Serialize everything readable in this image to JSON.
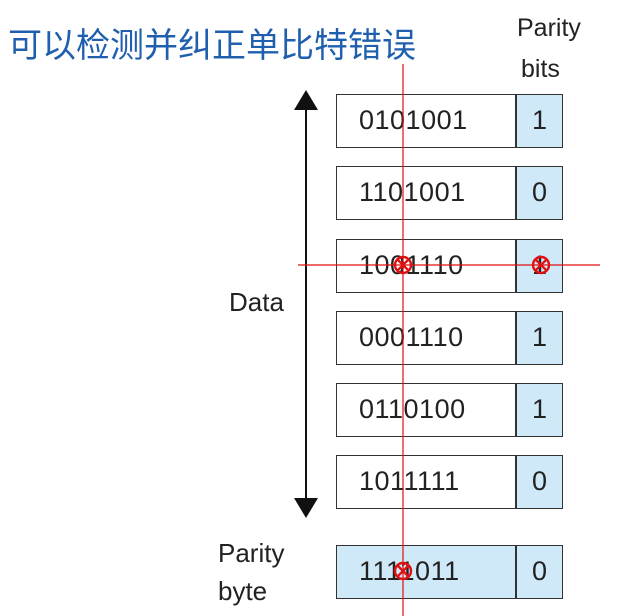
{
  "title": "可以检测并纠正单比特错误",
  "header": {
    "parity_line1": "Parity",
    "parity_line2": "bits"
  },
  "labels": {
    "data": "Data",
    "parity_byte_line1": "Parity",
    "parity_byte_line2": "byte"
  },
  "rows": [
    {
      "bits": "0101001",
      "parity": "1"
    },
    {
      "bits": "1101001",
      "parity": "0"
    },
    {
      "bits": "1001110",
      "parity": "1"
    },
    {
      "bits": "0001110",
      "parity": "1"
    },
    {
      "bits": "0110100",
      "parity": "1"
    },
    {
      "bits": "1011111",
      "parity": "0"
    }
  ],
  "parity_byte": {
    "bits": "1111011",
    "parity": "0"
  },
  "colors": {
    "title": "#1f5fae",
    "cell_fill": "#cfe9f9",
    "crosshair": "#e01010"
  }
}
